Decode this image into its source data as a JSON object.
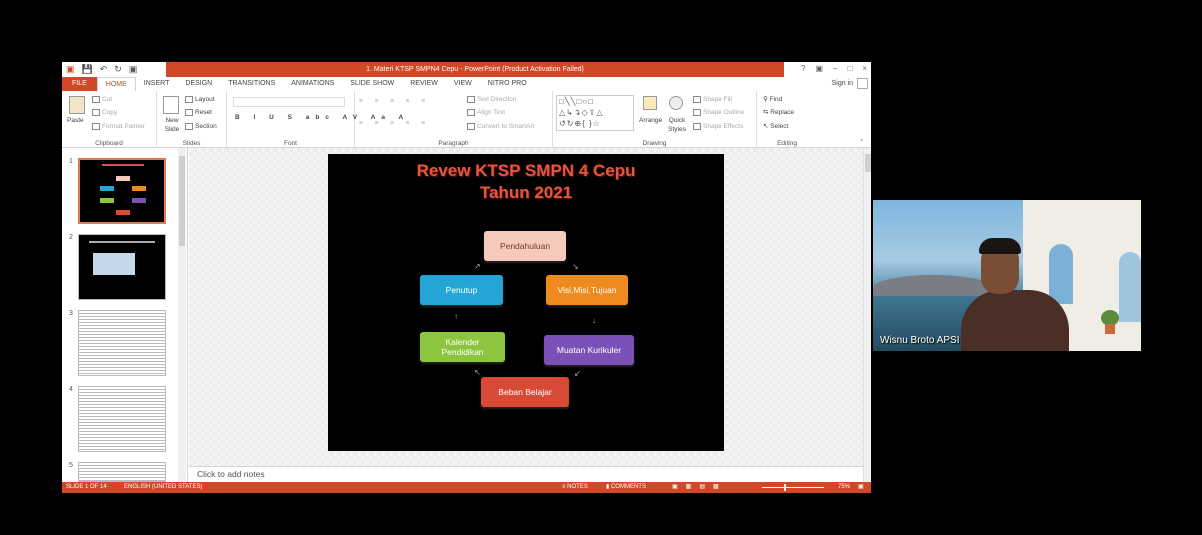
{
  "window": {
    "title": "1. Materi KTSP SMPN4 Cepu - PowerPoint (Product Activation Failed)",
    "sign_in": "Sign in"
  },
  "tabs": [
    "FILE",
    "HOME",
    "INSERT",
    "DESIGN",
    "TRANSITIONS",
    "ANIMATIONS",
    "SLIDE SHOW",
    "REVIEW",
    "VIEW",
    "NITRO PRO"
  ],
  "ribbon": {
    "clipboard": {
      "label": "Clipboard",
      "paste": "Paste",
      "cut": "Cut",
      "copy": "Copy",
      "format_painter": "Format Painter"
    },
    "slides": {
      "label": "Slides",
      "new_slide": "New Slide",
      "layout": "Layout",
      "reset": "Reset",
      "section": "Section"
    },
    "font": {
      "label": "Font"
    },
    "paragraph": {
      "label": "Paragraph",
      "text_direction": "Text Direction",
      "align_text": "Align Text",
      "convert": "Convert to SmartArt"
    },
    "drawing": {
      "label": "Drawing",
      "arrange": "Arrange",
      "quick_styles": "Quick Styles",
      "shape_fill": "Shape Fill",
      "shape_outline": "Shape Outline",
      "shape_effects": "Shape Effects"
    },
    "editing": {
      "label": "Editing",
      "find": "Find",
      "replace": "Replace",
      "select": "Select"
    }
  },
  "thumbnails": [
    "1",
    "2",
    "3",
    "4",
    "5"
  ],
  "slide": {
    "title_line1": "Revew KTSP SMPN 4 Cepu",
    "title_line2": "Tahun 2021",
    "boxes": {
      "pendahuluan": "Pendahuluan",
      "visi": "Visi,Misi,Tujuan",
      "muatan": "Muatan Kurikuler",
      "beban": "Beban Belajar",
      "kalender": "Kalender Pendidikan",
      "penutup": "Penutup"
    },
    "colors": {
      "pendahuluan": "#f6c9bd",
      "visi": "#ef8a1e",
      "muatan": "#7b51b7",
      "beban": "#d94a36",
      "kalender": "#8cc63e",
      "penutup": "#23a6d5",
      "title": "#e8553c"
    }
  },
  "notes": {
    "placeholder": "Click to add notes"
  },
  "status": {
    "slide_info": "SLIDE 1 OF 14",
    "language": "ENGLISH (UNITED STATES)",
    "notes": "NOTES",
    "comments": "COMMENTS",
    "zoom": "75%"
  },
  "webcam": {
    "participant_name": "Wisnu Broto APSI"
  },
  "accent_color": "#d24726"
}
